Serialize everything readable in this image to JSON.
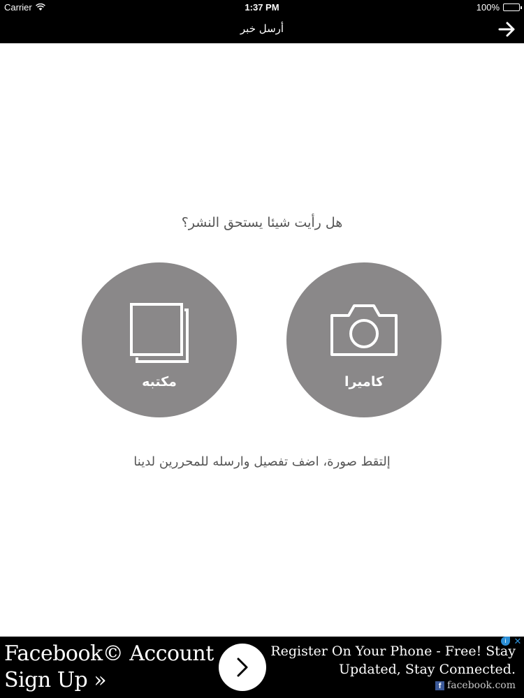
{
  "status_bar": {
    "carrier": "Carrier",
    "time": "1:37 PM",
    "battery": "100%"
  },
  "nav": {
    "title": "أرسل خبر",
    "back_icon": "arrow-right-icon"
  },
  "main": {
    "question": "هل رأيت شيئا يستحق النشر؟",
    "buttons": {
      "library": {
        "label": "مكتبه",
        "icon": "photo-library-icon"
      },
      "camera": {
        "label": "كاميرا",
        "icon": "camera-icon"
      }
    },
    "caption": "إلتقط صورة، اضف تفصيل وارسله للمحررين لدينا"
  },
  "ad": {
    "headline": "Facebook© Account Sign Up »",
    "headline_line1": "Facebook© Account",
    "headline_line2": "Sign Up »",
    "body_line1": "Register On Your Phone - Free! Stay",
    "body_line2": "Updated, Stay Connected.",
    "source": "facebook.com",
    "choices_icon": "i",
    "close_icon": "✕"
  },
  "colors": {
    "bar_bg": "#000000",
    "circle_bg": "#8a8889",
    "text_gray": "#555555"
  }
}
